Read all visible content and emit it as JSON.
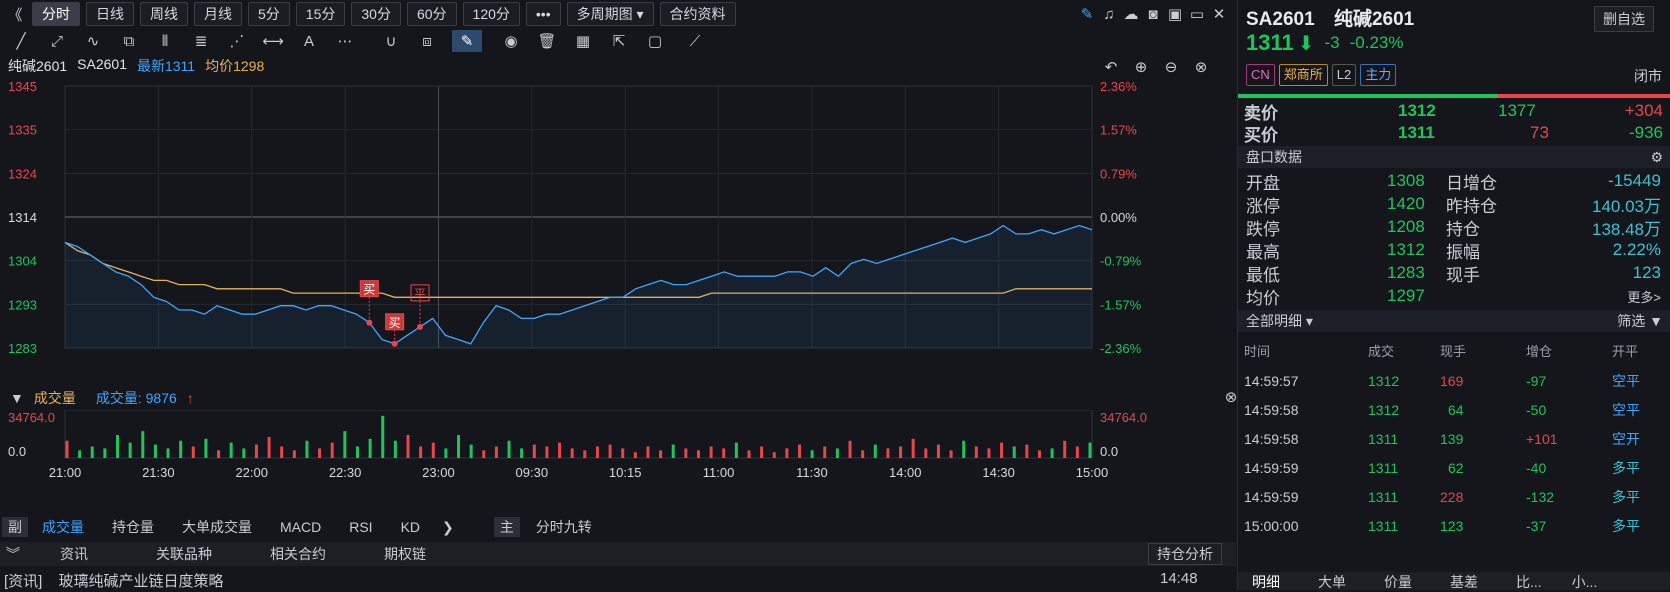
{
  "toolbar": {
    "periods": [
      "分时",
      "日线",
      "周线",
      "月线",
      "5分",
      "15分",
      "30分",
      "60分",
      "120分"
    ],
    "more": "•••",
    "multi_period": "多周期图",
    "contract_info": "合约资料"
  },
  "chart_header": {
    "name": "纯碱2601",
    "code": "SA2601",
    "latest_label": "最新1311",
    "avg_label": "均价1298"
  },
  "chart_data": {
    "type": "line",
    "y_left_ticks": [
      "1345",
      "1335",
      "1324",
      "1314",
      "1304",
      "1293",
      "1283"
    ],
    "y_right_ticks": [
      "2.36%",
      "1.57%",
      "0.79%",
      "0.00%",
      "-0.79%",
      "-1.57%",
      "-2.36%"
    ],
    "ylim": [
      1283,
      1345
    ],
    "prev_settle": 1314,
    "x_ticks": [
      "21:00",
      "21:30",
      "22:00",
      "22:30",
      "23:00",
      "09:30",
      "10:15",
      "11:00",
      "11:30",
      "14:00",
      "14:30",
      "15:00"
    ],
    "series": [
      {
        "name": "最新",
        "values": [
          1308,
          1307,
          1305,
          1303,
          1301,
          1300,
          1298,
          1295,
          1294,
          1292,
          1292,
          1291,
          1293,
          1292,
          1291,
          1291,
          1292,
          1293,
          1293,
          1292,
          1293,
          1293,
          1292,
          1291,
          1289,
          1285,
          1284,
          1286,
          1288,
          1290,
          1286,
          1285,
          1284,
          1289,
          1293,
          1292,
          1290,
          1290,
          1291,
          1291,
          1292,
          1293,
          1294,
          1295,
          1295,
          1297,
          1298,
          1299,
          1298,
          1298,
          1299,
          1300,
          1301,
          1300,
          1300,
          1300,
          1300,
          1301,
          1301,
          1300,
          1302,
          1300,
          1303,
          1304,
          1303,
          1304,
          1305,
          1306,
          1307,
          1308,
          1309,
          1308,
          1309,
          1310,
          1312,
          1310,
          1310,
          1311,
          1310,
          1311,
          1312,
          1311
        ]
      },
      {
        "name": "均价",
        "values": [
          1308,
          1306,
          1305,
          1303,
          1302,
          1301,
          1300,
          1299,
          1299,
          1298,
          1298,
          1298,
          1297,
          1297,
          1297,
          1297,
          1297,
          1297,
          1296,
          1296,
          1296,
          1296,
          1296,
          1296,
          1296,
          1296,
          1295,
          1295,
          1295,
          1295,
          1295,
          1295,
          1295,
          1295,
          1295,
          1295,
          1295,
          1295,
          1295,
          1295,
          1295,
          1295,
          1295,
          1295,
          1295,
          1295,
          1295,
          1295,
          1295,
          1295,
          1295,
          1296,
          1296,
          1296,
          1296,
          1296,
          1296,
          1296,
          1296,
          1296,
          1296,
          1296,
          1296,
          1296,
          1296,
          1296,
          1296,
          1296,
          1296,
          1296,
          1296,
          1296,
          1296,
          1296,
          1296,
          1297,
          1297,
          1297,
          1297,
          1297,
          1297,
          1297
        ]
      }
    ],
    "markers": [
      {
        "label": "买",
        "index": 24
      },
      {
        "label": "买",
        "index": 26
      },
      {
        "label": "平",
        "index": 28
      }
    ],
    "volume": {
      "label": "成交量",
      "value_label": "成交量: 9876",
      "y_top": "34764.0",
      "y_bottom": "0.0",
      "bars": [
        9,
        4,
        6,
        5,
        12,
        8,
        14,
        7,
        5,
        9,
        6,
        10,
        4,
        8,
        5,
        7,
        11,
        6,
        4,
        9,
        5,
        8,
        14,
        6,
        10,
        22,
        9,
        12,
        6,
        8,
        5,
        12,
        7,
        4,
        6,
        9,
        5,
        7,
        6,
        8,
        5,
        4,
        6,
        7,
        5,
        3,
        6,
        4,
        7,
        5,
        4,
        6,
        5,
        8,
        4,
        6,
        3,
        5,
        7,
        4,
        6,
        5,
        9,
        4,
        7,
        5,
        6,
        10,
        5,
        7,
        4,
        9,
        6,
        5,
        8,
        6,
        7,
        4,
        5,
        9,
        6,
        8
      ]
    }
  },
  "sub_tabs": {
    "fu": "副",
    "items": [
      "成交量",
      "持仓量",
      "大单成交量",
      "MACD",
      "RSI",
      "KD"
    ],
    "zhu": "主",
    "zhu_item": "分时九转"
  },
  "bottom_tabs": {
    "items": [
      "资讯",
      "关联品种",
      "相关合约",
      "期权链"
    ],
    "position_analysis": "持仓分析"
  },
  "news": {
    "tag": "[资讯]",
    "title": "玻璃纯碱产业链日度策略",
    "time": "14:48"
  },
  "quote": {
    "code": "SA2601",
    "name": "纯碱2601",
    "favorite_btn": "删自选",
    "price": "1311",
    "change": "-3",
    "change_pct": "-0.23%",
    "tags": [
      "CN",
      "郑商所",
      "L2",
      "主力"
    ],
    "status": "闭市",
    "ask_label": "卖价",
    "ask_price": "1312",
    "ask_vol": "1377",
    "ask_diff": "+304",
    "bid_label": "买价",
    "bid_price": "1311",
    "bid_vol": "73",
    "bid_diff": "-936",
    "panel_title": "盘口数据",
    "stats": [
      {
        "k1": "开盘",
        "v1": "1308",
        "k2": "日增仓",
        "v2": "-15449"
      },
      {
        "k1": "涨停",
        "v1": "1420",
        "k2": "昨持仓",
        "v2": "140.03万"
      },
      {
        "k1": "跌停",
        "v1": "1208",
        "k2": "持仓",
        "v2": "138.48万"
      },
      {
        "k1": "最高",
        "v1": "1312",
        "k2": "振幅",
        "v2": "2.22%"
      },
      {
        "k1": "最低",
        "v1": "1283",
        "k2": "现手",
        "v2": "123"
      },
      {
        "k1": "均价",
        "v1": "1297",
        "k2": "",
        "v2": "更多>"
      }
    ]
  },
  "ticks": {
    "title": "全部明细",
    "filter": "筛选",
    "headers": [
      "时间",
      "成交",
      "现手",
      "增仓",
      "开平"
    ],
    "rows": [
      {
        "time": "14:59:57",
        "price": "1312",
        "vol": "169",
        "oi": "-97",
        "type": "空平"
      },
      {
        "time": "14:59:58",
        "price": "1312",
        "vol": "64",
        "oi": "-50",
        "type": "空平"
      },
      {
        "time": "14:59:58",
        "price": "1311",
        "vol": "139",
        "oi": "+101",
        "type": "空开"
      },
      {
        "time": "14:59:59",
        "price": "1311",
        "vol": "62",
        "oi": "-40",
        "type": "多平"
      },
      {
        "time": "14:59:59",
        "price": "1311",
        "vol": "228",
        "oi": "-132",
        "type": "多平"
      },
      {
        "time": "15:00:00",
        "price": "1311",
        "vol": "123",
        "oi": "-37",
        "type": "多平"
      }
    ],
    "bottom_tabs": [
      "明细",
      "大单",
      "价量",
      "基差",
      "比...",
      "小..."
    ]
  }
}
